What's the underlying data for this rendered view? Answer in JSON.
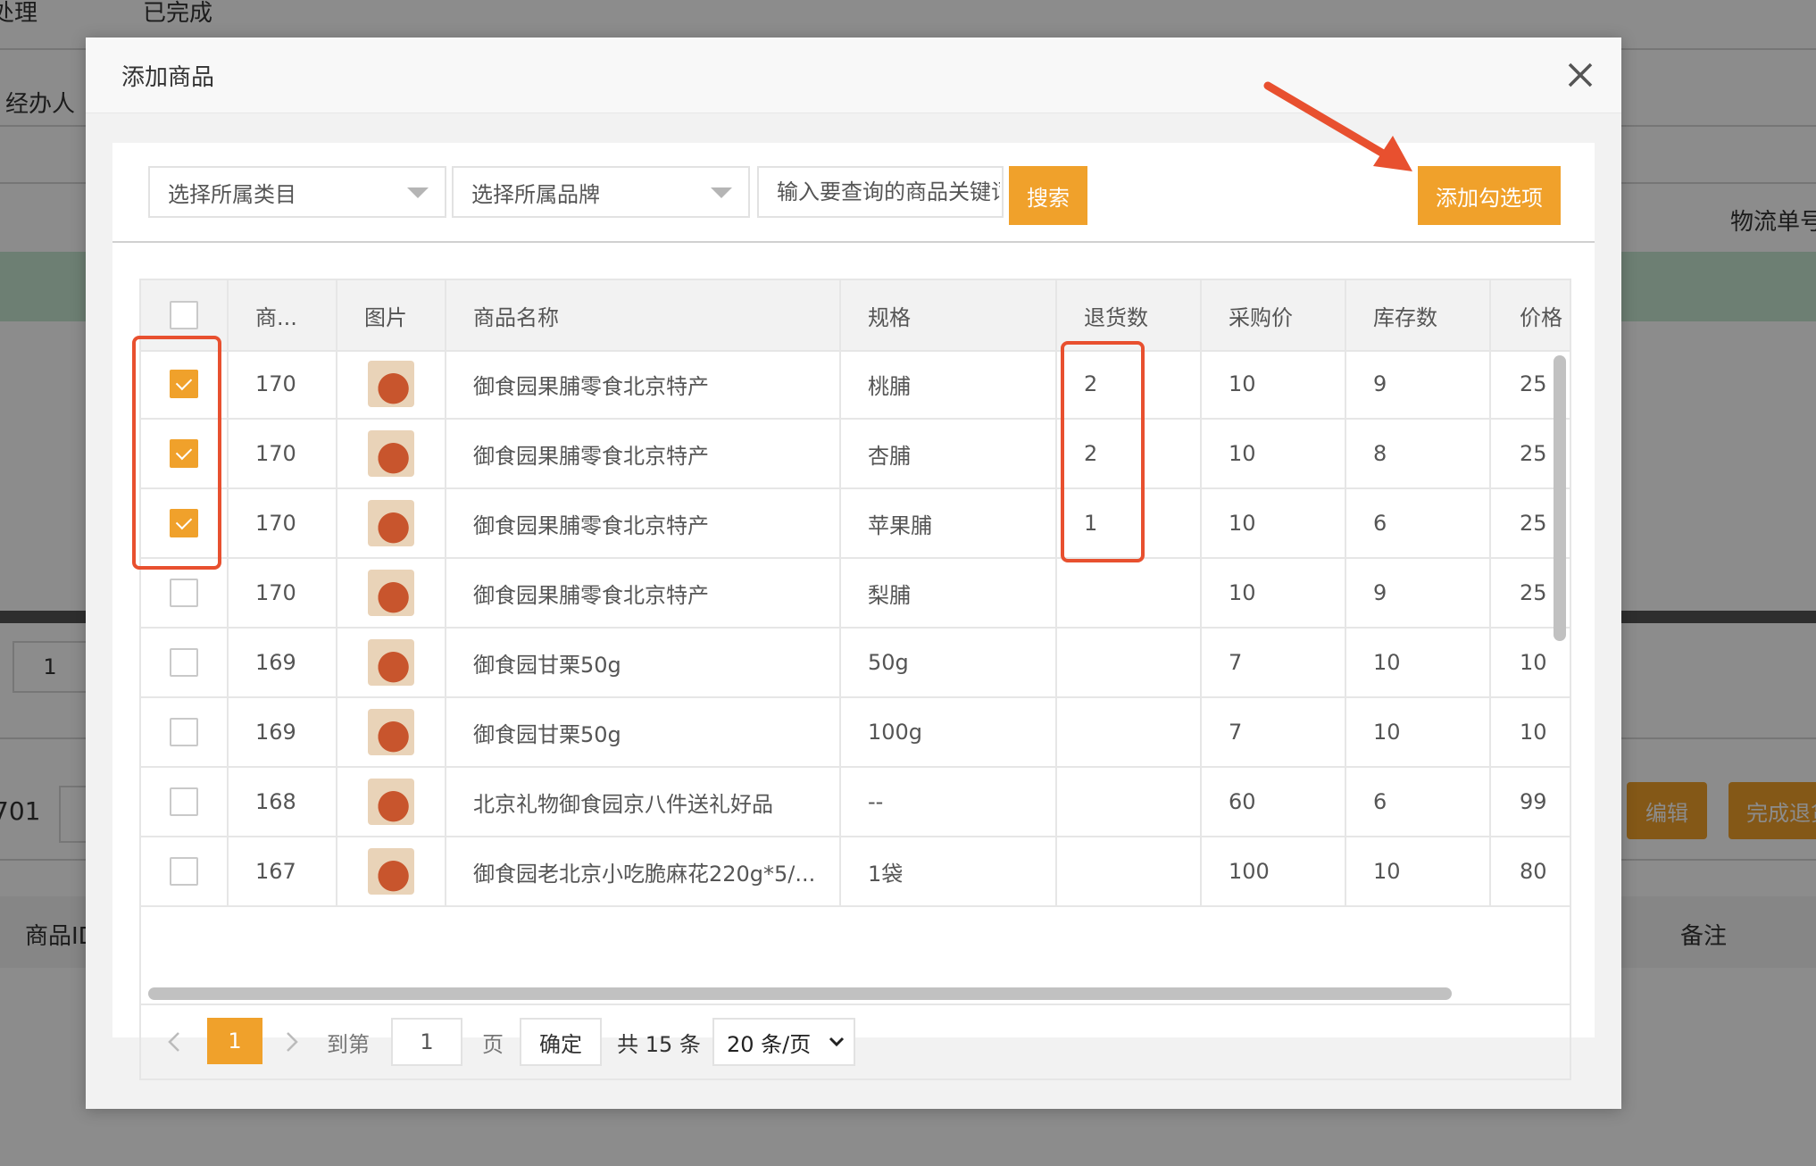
{
  "background": {
    "tab_partial_left": "处理",
    "tab_done": "已完成",
    "filter_handler": "经办人",
    "col_logistics": "物流单号",
    "page_input_value": "1",
    "order_no_partial": "701",
    "btn_edit": "编辑",
    "btn_complete_partial": "完成退货",
    "col_product_id": "商品ID",
    "col_remark": "备注"
  },
  "modal": {
    "title": "添加商品",
    "filters": {
      "category_placeholder": "选择所属类目",
      "brand_placeholder": "选择所属品牌",
      "keyword_placeholder": "输入要查询的商品关键词",
      "search_label": "搜索",
      "add_checked_label": "添加勾选项"
    },
    "table": {
      "headers": [
        "商...",
        "图片",
        "商品名称",
        "规格",
        "退货数",
        "采购价",
        "库存数",
        "价格"
      ],
      "rows": [
        {
          "checked": true,
          "id": "170",
          "name": "御食园果脯零食北京特产",
          "spec": "桃脯",
          "return_qty": "2",
          "purchase_price": "10",
          "stock": "9",
          "price": "25"
        },
        {
          "checked": true,
          "id": "170",
          "name": "御食园果脯零食北京特产",
          "spec": "杏脯",
          "return_qty": "2",
          "purchase_price": "10",
          "stock": "8",
          "price": "25"
        },
        {
          "checked": true,
          "id": "170",
          "name": "御食园果脯零食北京特产",
          "spec": "苹果脯",
          "return_qty": "1",
          "purchase_price": "10",
          "stock": "6",
          "price": "25"
        },
        {
          "checked": false,
          "id": "170",
          "name": "御食园果脯零食北京特产",
          "spec": "梨脯",
          "return_qty": "",
          "purchase_price": "10",
          "stock": "9",
          "price": "25"
        },
        {
          "checked": false,
          "id": "169",
          "name": "御食园甘栗50g",
          "spec": "50g",
          "return_qty": "",
          "purchase_price": "7",
          "stock": "10",
          "price": "10"
        },
        {
          "checked": false,
          "id": "169",
          "name": "御食园甘栗50g",
          "spec": "100g",
          "return_qty": "",
          "purchase_price": "7",
          "stock": "10",
          "price": "10"
        },
        {
          "checked": false,
          "id": "168",
          "name": "北京礼物御食园京八件送礼好品",
          "spec": "--",
          "return_qty": "",
          "purchase_price": "60",
          "stock": "6",
          "price": "99"
        },
        {
          "checked": false,
          "id": "167",
          "name": "御食园老北京小吃脆麻花220g*5/...",
          "spec": "1袋",
          "return_qty": "",
          "purchase_price": "100",
          "stock": "10",
          "price": "80"
        }
      ]
    },
    "pagination": {
      "current_page": "1",
      "goto_label": "到第",
      "goto_value": "1",
      "page_unit": "页",
      "confirm_label": "确定",
      "total_label": "共 15 条",
      "page_size_label": "20 条/页"
    }
  },
  "colors": {
    "accent": "#f0a12b",
    "annotation": "#e8502f"
  }
}
